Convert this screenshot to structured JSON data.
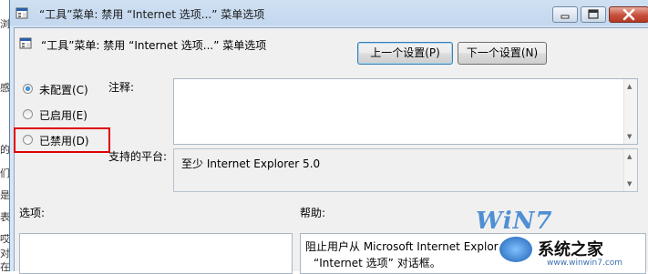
{
  "window": {
    "title": "“工具”菜单: 禁用 “Internet 选项...” 菜单选项",
    "minimize": "minimize",
    "maximize": "maximize",
    "close": "close"
  },
  "background_chars": [
    "浏",
    "感",
    "的",
    "们",
    "是",
    "表",
    "哎",
    "对",
    "在"
  ],
  "policy": {
    "title": "“工具”菜单: 禁用 “Internet 选项...” 菜单选项",
    "prev_button": "上一个设置(P)",
    "next_button": "下一个设置(N)"
  },
  "radios": [
    {
      "label": "未配置(C)",
      "checked": true
    },
    {
      "label": "已启用(E)",
      "checked": false
    },
    {
      "label": "已禁用(D)",
      "checked": false
    }
  ],
  "comment": {
    "label": "注释:",
    "value": ""
  },
  "platform": {
    "label": "支持的平台:",
    "value": "至少 Internet Explorer 5.0"
  },
  "options": {
    "label": "选项:"
  },
  "help": {
    "label": "帮助:",
    "line1": "阻止用户从 Microsoft Internet Explor",
    "line2": "“Internet 选项” 对话框。"
  },
  "watermark": {
    "brand": "WiN7",
    "site_name": "系统之家",
    "url": "www.winwin7.com"
  },
  "colors": {
    "highlight": "#e00000",
    "titlebar": "#c3d7ee",
    "client": "#f0f0f0"
  }
}
